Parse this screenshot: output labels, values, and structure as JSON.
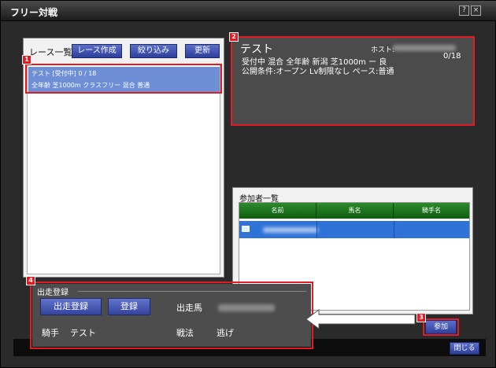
{
  "window": {
    "title": "フリー対戦",
    "help_label": "?",
    "close_label": "×"
  },
  "race_list": {
    "label": "レース一覧",
    "buttons": {
      "create": "レース作成",
      "filter": "絞り込み",
      "refresh": "更新"
    },
    "items": [
      {
        "line1": "テスト [受付中] 0 / 18",
        "line2": "全年齢  芝1000m  クラスフリー  混合  普通"
      }
    ]
  },
  "detail": {
    "name": "テスト",
    "host_label": "ホスト:",
    "count": "0/18",
    "line1": "受付中  混合  全年齢  新潟  芝1000m  ー  良",
    "line2": "公開条件:オープン  Lv制限なし  ペース:普通"
  },
  "participants": {
    "label": "参加者一覧",
    "columns": [
      "名前",
      "馬名",
      "騎手名"
    ]
  },
  "entry": {
    "label": "出走登録",
    "register_button": "出走登録",
    "sign_button": "登録",
    "horse_label": "出走馬",
    "jockey_label": "騎手",
    "jockey_value": "テスト",
    "tactic_label": "戦法",
    "tactic_value": "逃げ"
  },
  "join_button": "参加",
  "close_button": "閉じる",
  "badges": [
    "1",
    "2",
    "3",
    "4"
  ],
  "colors": {
    "highlight": "#e31b23",
    "row_selected": "#2f73d8",
    "button_blue": "#3d4fb0",
    "table_header": "#1e7a1e"
  }
}
